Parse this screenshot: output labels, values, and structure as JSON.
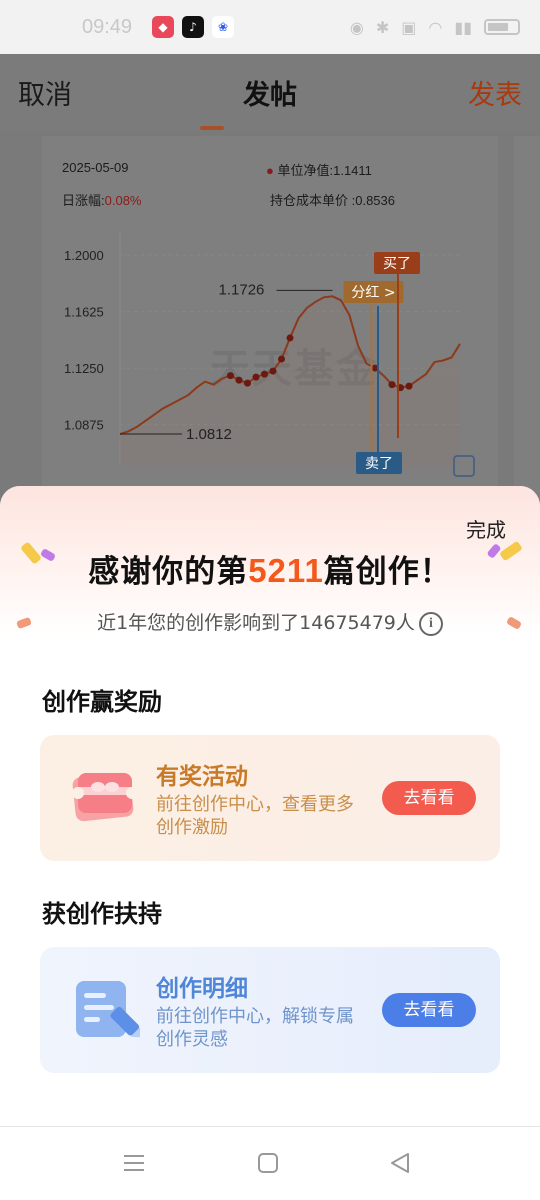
{
  "status_bar": {
    "time": "09:49",
    "app_icons": [
      "app-icon-red",
      "tiktok-icon",
      "baidu-icon"
    ]
  },
  "top_nav": {
    "cancel": "取消",
    "title": "发帖",
    "publish": "发表"
  },
  "chart_card": {
    "date": "2025-05-09",
    "daily_change_label": "日涨幅:",
    "daily_change_value": "0.08%",
    "nav_label": "单位净值:",
    "nav_value": "1.1411",
    "cost_label": "持仓成本单价 :",
    "cost_value": "0.8536",
    "watermark": "天天基金",
    "markers": {
      "buy": "买了",
      "sell": "卖了",
      "dividend": "分红 >"
    }
  },
  "chart_data": {
    "type": "line",
    "yticks": [
      "1.2000",
      "1.1625",
      "1.1250",
      "1.0875"
    ],
    "ylim": [
      1.06,
      1.21
    ],
    "annotations": {
      "max": "1.1726",
      "min": "1.0812"
    },
    "x": [
      0,
      1,
      2,
      3,
      4,
      5,
      6,
      7,
      8,
      9,
      10,
      11,
      12,
      13,
      14,
      15,
      16,
      17,
      18,
      19,
      20,
      21,
      22,
      23,
      24,
      25,
      26,
      27,
      28,
      29,
      30,
      31,
      32,
      33,
      34,
      35,
      36,
      37,
      38,
      39,
      40
    ],
    "values": [
      1.0812,
      1.083,
      1.086,
      1.09,
      1.094,
      1.098,
      1.101,
      1.104,
      1.107,
      1.112,
      1.116,
      1.114,
      1.118,
      1.12,
      1.117,
      1.115,
      1.119,
      1.121,
      1.123,
      1.131,
      1.145,
      1.158,
      1.165,
      1.169,
      1.172,
      1.1726,
      1.17,
      1.16,
      1.14,
      1.128,
      1.125,
      1.12,
      1.114,
      1.112,
      1.113,
      1.117,
      1.121,
      1.129,
      1.13,
      1.132,
      1.1411
    ],
    "dots": [
      13,
      14,
      15,
      16,
      17,
      18,
      19,
      20,
      30,
      32,
      33,
      34
    ]
  },
  "sheet": {
    "done": "完成",
    "thanks_prefix": "感谢你的第",
    "thanks_number": "5211",
    "thanks_suffix": "篇创作！",
    "impact_text": "近1年您的创作影响到了14675479人",
    "section_reward": "创作赢奖励",
    "section_support": "获创作扶持",
    "reward_card": {
      "title": "有奖活动",
      "desc": "前往创作中心，查看更多创作激励",
      "button": "去看看"
    },
    "detail_card": {
      "title": "创作明细",
      "desc": "前往创作中心，解锁专属创作灵感",
      "button": "去看看"
    }
  },
  "colors": {
    "accent_orange": "#f2591a",
    "reward_button": "#f25b4e",
    "detail_button": "#4c7ee8"
  }
}
